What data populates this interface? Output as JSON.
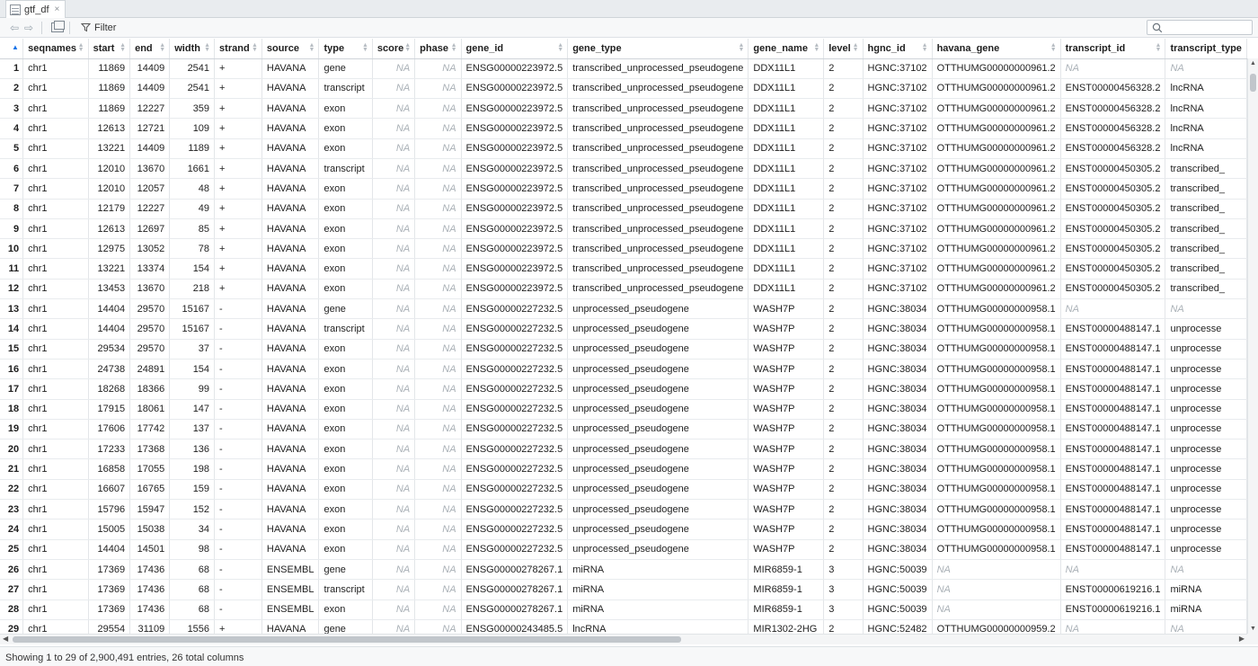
{
  "tab": {
    "title": "gtf_df",
    "close": "×"
  },
  "toolbar": {
    "filter_label": "Filter",
    "search_placeholder": ""
  },
  "columns": [
    "seqnames",
    "start",
    "end",
    "width",
    "strand",
    "source",
    "type",
    "score",
    "phase",
    "gene_id",
    "gene_type",
    "gene_name",
    "level",
    "hgnc_id",
    "havana_gene",
    "transcript_id",
    "transcript_type"
  ],
  "rows": [
    [
      "1",
      "chr1",
      "11869",
      "14409",
      "2541",
      "+",
      "HAVANA",
      "gene",
      "NA",
      "NA",
      "ENSG00000223972.5",
      "transcribed_unprocessed_pseudogene",
      "DDX11L1",
      "2",
      "HGNC:37102",
      "OTTHUMG00000000961.2",
      "NA",
      "NA"
    ],
    [
      "2",
      "chr1",
      "11869",
      "14409",
      "2541",
      "+",
      "HAVANA",
      "transcript",
      "NA",
      "NA",
      "ENSG00000223972.5",
      "transcribed_unprocessed_pseudogene",
      "DDX11L1",
      "2",
      "HGNC:37102",
      "OTTHUMG00000000961.2",
      "ENST00000456328.2",
      "lncRNA"
    ],
    [
      "3",
      "chr1",
      "11869",
      "12227",
      "359",
      "+",
      "HAVANA",
      "exon",
      "NA",
      "NA",
      "ENSG00000223972.5",
      "transcribed_unprocessed_pseudogene",
      "DDX11L1",
      "2",
      "HGNC:37102",
      "OTTHUMG00000000961.2",
      "ENST00000456328.2",
      "lncRNA"
    ],
    [
      "4",
      "chr1",
      "12613",
      "12721",
      "109",
      "+",
      "HAVANA",
      "exon",
      "NA",
      "NA",
      "ENSG00000223972.5",
      "transcribed_unprocessed_pseudogene",
      "DDX11L1",
      "2",
      "HGNC:37102",
      "OTTHUMG00000000961.2",
      "ENST00000456328.2",
      "lncRNA"
    ],
    [
      "5",
      "chr1",
      "13221",
      "14409",
      "1189",
      "+",
      "HAVANA",
      "exon",
      "NA",
      "NA",
      "ENSG00000223972.5",
      "transcribed_unprocessed_pseudogene",
      "DDX11L1",
      "2",
      "HGNC:37102",
      "OTTHUMG00000000961.2",
      "ENST00000456328.2",
      "lncRNA"
    ],
    [
      "6",
      "chr1",
      "12010",
      "13670",
      "1661",
      "+",
      "HAVANA",
      "transcript",
      "NA",
      "NA",
      "ENSG00000223972.5",
      "transcribed_unprocessed_pseudogene",
      "DDX11L1",
      "2",
      "HGNC:37102",
      "OTTHUMG00000000961.2",
      "ENST00000450305.2",
      "transcribed_"
    ],
    [
      "7",
      "chr1",
      "12010",
      "12057",
      "48",
      "+",
      "HAVANA",
      "exon",
      "NA",
      "NA",
      "ENSG00000223972.5",
      "transcribed_unprocessed_pseudogene",
      "DDX11L1",
      "2",
      "HGNC:37102",
      "OTTHUMG00000000961.2",
      "ENST00000450305.2",
      "transcribed_"
    ],
    [
      "8",
      "chr1",
      "12179",
      "12227",
      "49",
      "+",
      "HAVANA",
      "exon",
      "NA",
      "NA",
      "ENSG00000223972.5",
      "transcribed_unprocessed_pseudogene",
      "DDX11L1",
      "2",
      "HGNC:37102",
      "OTTHUMG00000000961.2",
      "ENST00000450305.2",
      "transcribed_"
    ],
    [
      "9",
      "chr1",
      "12613",
      "12697",
      "85",
      "+",
      "HAVANA",
      "exon",
      "NA",
      "NA",
      "ENSG00000223972.5",
      "transcribed_unprocessed_pseudogene",
      "DDX11L1",
      "2",
      "HGNC:37102",
      "OTTHUMG00000000961.2",
      "ENST00000450305.2",
      "transcribed_"
    ],
    [
      "10",
      "chr1",
      "12975",
      "13052",
      "78",
      "+",
      "HAVANA",
      "exon",
      "NA",
      "NA",
      "ENSG00000223972.5",
      "transcribed_unprocessed_pseudogene",
      "DDX11L1",
      "2",
      "HGNC:37102",
      "OTTHUMG00000000961.2",
      "ENST00000450305.2",
      "transcribed_"
    ],
    [
      "11",
      "chr1",
      "13221",
      "13374",
      "154",
      "+",
      "HAVANA",
      "exon",
      "NA",
      "NA",
      "ENSG00000223972.5",
      "transcribed_unprocessed_pseudogene",
      "DDX11L1",
      "2",
      "HGNC:37102",
      "OTTHUMG00000000961.2",
      "ENST00000450305.2",
      "transcribed_"
    ],
    [
      "12",
      "chr1",
      "13453",
      "13670",
      "218",
      "+",
      "HAVANA",
      "exon",
      "NA",
      "NA",
      "ENSG00000223972.5",
      "transcribed_unprocessed_pseudogene",
      "DDX11L1",
      "2",
      "HGNC:37102",
      "OTTHUMG00000000961.2",
      "ENST00000450305.2",
      "transcribed_"
    ],
    [
      "13",
      "chr1",
      "14404",
      "29570",
      "15167",
      "-",
      "HAVANA",
      "gene",
      "NA",
      "NA",
      "ENSG00000227232.5",
      "unprocessed_pseudogene",
      "WASH7P",
      "2",
      "HGNC:38034",
      "OTTHUMG00000000958.1",
      "NA",
      "NA"
    ],
    [
      "14",
      "chr1",
      "14404",
      "29570",
      "15167",
      "-",
      "HAVANA",
      "transcript",
      "NA",
      "NA",
      "ENSG00000227232.5",
      "unprocessed_pseudogene",
      "WASH7P",
      "2",
      "HGNC:38034",
      "OTTHUMG00000000958.1",
      "ENST00000488147.1",
      "unprocesse"
    ],
    [
      "15",
      "chr1",
      "29534",
      "29570",
      "37",
      "-",
      "HAVANA",
      "exon",
      "NA",
      "NA",
      "ENSG00000227232.5",
      "unprocessed_pseudogene",
      "WASH7P",
      "2",
      "HGNC:38034",
      "OTTHUMG00000000958.1",
      "ENST00000488147.1",
      "unprocesse"
    ],
    [
      "16",
      "chr1",
      "24738",
      "24891",
      "154",
      "-",
      "HAVANA",
      "exon",
      "NA",
      "NA",
      "ENSG00000227232.5",
      "unprocessed_pseudogene",
      "WASH7P",
      "2",
      "HGNC:38034",
      "OTTHUMG00000000958.1",
      "ENST00000488147.1",
      "unprocesse"
    ],
    [
      "17",
      "chr1",
      "18268",
      "18366",
      "99",
      "-",
      "HAVANA",
      "exon",
      "NA",
      "NA",
      "ENSG00000227232.5",
      "unprocessed_pseudogene",
      "WASH7P",
      "2",
      "HGNC:38034",
      "OTTHUMG00000000958.1",
      "ENST00000488147.1",
      "unprocesse"
    ],
    [
      "18",
      "chr1",
      "17915",
      "18061",
      "147",
      "-",
      "HAVANA",
      "exon",
      "NA",
      "NA",
      "ENSG00000227232.5",
      "unprocessed_pseudogene",
      "WASH7P",
      "2",
      "HGNC:38034",
      "OTTHUMG00000000958.1",
      "ENST00000488147.1",
      "unprocesse"
    ],
    [
      "19",
      "chr1",
      "17606",
      "17742",
      "137",
      "-",
      "HAVANA",
      "exon",
      "NA",
      "NA",
      "ENSG00000227232.5",
      "unprocessed_pseudogene",
      "WASH7P",
      "2",
      "HGNC:38034",
      "OTTHUMG00000000958.1",
      "ENST00000488147.1",
      "unprocesse"
    ],
    [
      "20",
      "chr1",
      "17233",
      "17368",
      "136",
      "-",
      "HAVANA",
      "exon",
      "NA",
      "NA",
      "ENSG00000227232.5",
      "unprocessed_pseudogene",
      "WASH7P",
      "2",
      "HGNC:38034",
      "OTTHUMG00000000958.1",
      "ENST00000488147.1",
      "unprocesse"
    ],
    [
      "21",
      "chr1",
      "16858",
      "17055",
      "198",
      "-",
      "HAVANA",
      "exon",
      "NA",
      "NA",
      "ENSG00000227232.5",
      "unprocessed_pseudogene",
      "WASH7P",
      "2",
      "HGNC:38034",
      "OTTHUMG00000000958.1",
      "ENST00000488147.1",
      "unprocesse"
    ],
    [
      "22",
      "chr1",
      "16607",
      "16765",
      "159",
      "-",
      "HAVANA",
      "exon",
      "NA",
      "NA",
      "ENSG00000227232.5",
      "unprocessed_pseudogene",
      "WASH7P",
      "2",
      "HGNC:38034",
      "OTTHUMG00000000958.1",
      "ENST00000488147.1",
      "unprocesse"
    ],
    [
      "23",
      "chr1",
      "15796",
      "15947",
      "152",
      "-",
      "HAVANA",
      "exon",
      "NA",
      "NA",
      "ENSG00000227232.5",
      "unprocessed_pseudogene",
      "WASH7P",
      "2",
      "HGNC:38034",
      "OTTHUMG00000000958.1",
      "ENST00000488147.1",
      "unprocesse"
    ],
    [
      "24",
      "chr1",
      "15005",
      "15038",
      "34",
      "-",
      "HAVANA",
      "exon",
      "NA",
      "NA",
      "ENSG00000227232.5",
      "unprocessed_pseudogene",
      "WASH7P",
      "2",
      "HGNC:38034",
      "OTTHUMG00000000958.1",
      "ENST00000488147.1",
      "unprocesse"
    ],
    [
      "25",
      "chr1",
      "14404",
      "14501",
      "98",
      "-",
      "HAVANA",
      "exon",
      "NA",
      "NA",
      "ENSG00000227232.5",
      "unprocessed_pseudogene",
      "WASH7P",
      "2",
      "HGNC:38034",
      "OTTHUMG00000000958.1",
      "ENST00000488147.1",
      "unprocesse"
    ],
    [
      "26",
      "chr1",
      "17369",
      "17436",
      "68",
      "-",
      "ENSEMBL",
      "gene",
      "NA",
      "NA",
      "ENSG00000278267.1",
      "miRNA",
      "MIR6859-1",
      "3",
      "HGNC:50039",
      "NA",
      "NA",
      "NA"
    ],
    [
      "27",
      "chr1",
      "17369",
      "17436",
      "68",
      "-",
      "ENSEMBL",
      "transcript",
      "NA",
      "NA",
      "ENSG00000278267.1",
      "miRNA",
      "MIR6859-1",
      "3",
      "HGNC:50039",
      "NA",
      "ENST00000619216.1",
      "miRNA"
    ],
    [
      "28",
      "chr1",
      "17369",
      "17436",
      "68",
      "-",
      "ENSEMBL",
      "exon",
      "NA",
      "NA",
      "ENSG00000278267.1",
      "miRNA",
      "MIR6859-1",
      "3",
      "HGNC:50039",
      "NA",
      "ENST00000619216.1",
      "miRNA"
    ],
    [
      "29",
      "chr1",
      "29554",
      "31109",
      "1556",
      "+",
      "HAVANA",
      "gene",
      "NA",
      "NA",
      "ENSG00000243485.5",
      "lncRNA",
      "MIR1302-2HG",
      "2",
      "HGNC:52482",
      "OTTHUMG00000000959.2",
      "NA",
      "NA"
    ]
  ],
  "status": {
    "text": "Showing 1 to 29 of 2,900,491 entries, 26 total columns"
  }
}
